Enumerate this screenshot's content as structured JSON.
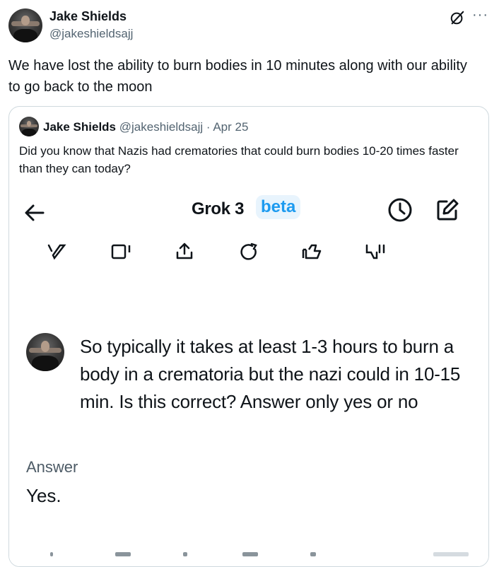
{
  "tweet": {
    "author_name": "Jake Shields",
    "author_handle": "@jakeshieldsajj",
    "text": "We have lost the ability to burn bodies in 10 minutes along with our ability to go back to the moon",
    "more_label": "···",
    "icons": [
      "grok-icon",
      "more-icon"
    ]
  },
  "quote": {
    "author_name": "Jake Shields",
    "author_handle": "@jakeshieldsajj",
    "separator": "·",
    "date": "Apr 25",
    "text": "Did you know that Nazis had crematories that could burn bodies 10-20 times faster than they can today?"
  },
  "screenshot": {
    "title": "Grok 3",
    "badge": "beta",
    "badge_color": "#1d9bf0",
    "icons": [
      "back-arrow-icon",
      "history-icon",
      "compose-icon",
      "brush-icon",
      "copy-icon",
      "share-icon",
      "regenerate-icon",
      "thumbs-up-icon",
      "thumbs-down-icon"
    ],
    "question": "So typically it takes at least 1-3 hours to burn a body in a crematoria but the nazi could in 10-15 min.  Is this correct? Answer only yes or no",
    "answer_label": "Answer",
    "answer_value": "Yes."
  }
}
